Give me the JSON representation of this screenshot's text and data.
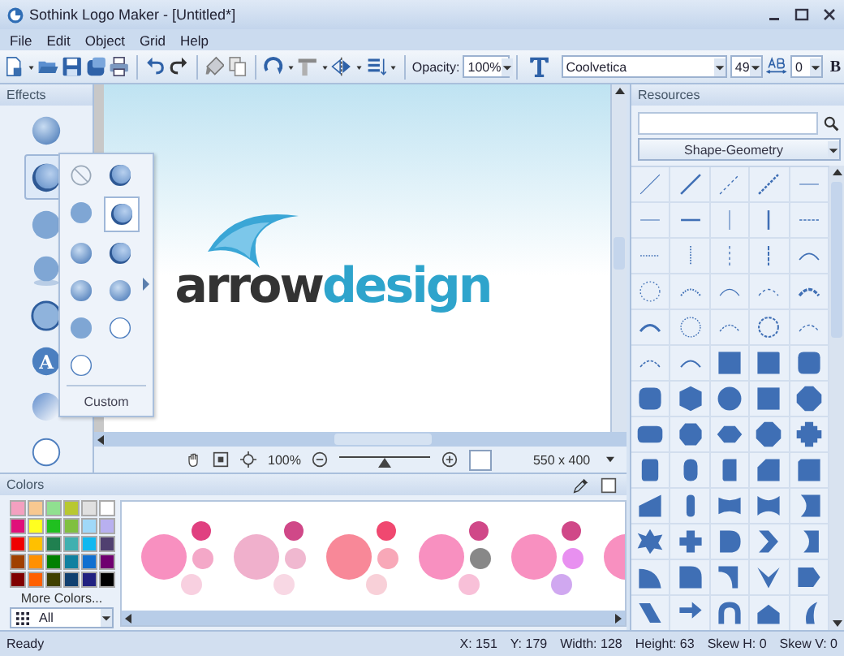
{
  "window": {
    "title": "Sothink Logo Maker - [Untitled*]"
  },
  "menu": [
    "File",
    "Edit",
    "Object",
    "Grid",
    "Help"
  ],
  "toolbar": {
    "opacity_label": "Opacity:",
    "opacity": "100%",
    "font": "Coolvetica",
    "font_size": "49",
    "spacing": "0",
    "bold": "B"
  },
  "effects_panel": {
    "title": "Effects",
    "items": [
      {
        "kind": "raised",
        "selected": false
      },
      {
        "kind": "ring",
        "selected": true
      },
      {
        "kind": "flat",
        "selected": false
      },
      {
        "kind": "shadow",
        "selected": false
      },
      {
        "kind": "outline",
        "selected": false
      },
      {
        "kind": "letter",
        "label": "A",
        "selected": false
      },
      {
        "kind": "gradient",
        "selected": false
      },
      {
        "kind": "hollow",
        "selected": false
      }
    ]
  },
  "effect_popup": {
    "options": [
      {
        "kind": "none",
        "selected": false
      },
      {
        "kind": "ring",
        "selected": false
      },
      {
        "kind": "flat",
        "selected": false
      },
      {
        "kind": "ring",
        "selected": true
      },
      {
        "kind": "raised",
        "selected": false
      },
      {
        "kind": "ring",
        "selected": false
      },
      {
        "kind": "raised",
        "selected": false
      },
      {
        "kind": "raised",
        "selected": false
      },
      {
        "kind": "flat",
        "selected": false
      },
      {
        "kind": "hollow",
        "selected": false
      },
      {
        "kind": "hollow",
        "selected": false
      }
    ],
    "custom": "Custom"
  },
  "canvas": {
    "logo": [
      {
        "text": "arrow",
        "color": "#333333"
      },
      {
        "text": "design",
        "color": "#2ea4cc"
      }
    ]
  },
  "canvas_toolbar": {
    "zoom": "100%",
    "zoom_slider": {
      "level": 0.5
    },
    "size": "550 x 400"
  },
  "colors_panel": {
    "title": "Colors",
    "swatches": [
      {
        "color": "#f4a0c0"
      },
      {
        "color": "#f8c890"
      },
      {
        "color": "#90e090"
      },
      {
        "color": "#b8c830"
      },
      {
        "color": "#e0e0e0"
      },
      {
        "color": "#ffffff"
      },
      {
        "color": "#e0107a"
      },
      {
        "color": "#ffff20"
      },
      {
        "color": "#20c020"
      },
      {
        "color": "#80c040"
      },
      {
        "color": "#a0d8f8"
      },
      {
        "color": "#b8b0f0"
      },
      {
        "color": "#f00000"
      },
      {
        "color": "#ffc000"
      },
      {
        "color": "#208050"
      },
      {
        "color": "#40b0b0"
      },
      {
        "color": "#10b8f0"
      },
      {
        "color": "#504070"
      },
      {
        "color": "#a04000"
      },
      {
        "color": "#ff9000"
      },
      {
        "color": "#008000"
      },
      {
        "color": "#1080a0"
      },
      {
        "color": "#1070d0"
      },
      {
        "color": "#700070"
      },
      {
        "color": "#800000"
      },
      {
        "color": "#ff6000"
      },
      {
        "color": "#404000"
      },
      {
        "color": "#104070"
      },
      {
        "color": "#202080"
      },
      {
        "color": "#000000"
      }
    ],
    "more_colors": "More Colors...",
    "filter": "All",
    "schemes": [
      {
        "swatches": [
          {
            "color": "#f890c0"
          },
          {
            "color": "#e04080"
          },
          {
            "color": "#f4a8c8"
          },
          {
            "color": "#f8d0e0"
          }
        ]
      },
      {
        "swatches": [
          {
            "color": "#f0b0cc"
          },
          {
            "color": "#d04888"
          },
          {
            "color": "#f0b8d0"
          },
          {
            "color": "#f8d8e4"
          }
        ]
      },
      {
        "swatches": [
          {
            "color": "#f88898"
          },
          {
            "color": "#f04870"
          },
          {
            "color": "#f8a8b8"
          },
          {
            "color": "#f8d0d8"
          }
        ]
      },
      {
        "swatches": [
          {
            "color": "#f890c0"
          },
          {
            "color": "#d04888"
          },
          {
            "color": "#888888"
          },
          {
            "color": "#f8c0d8"
          }
        ]
      },
      {
        "swatches": [
          {
            "color": "#f890c0"
          },
          {
            "color": "#d04888"
          },
          {
            "color": "#e890f0"
          },
          {
            "color": "#d0a8f0"
          }
        ]
      },
      {
        "swatches": [
          {
            "color": "#f890c0"
          }
        ]
      }
    ]
  },
  "resources_panel": {
    "title": "Resources",
    "category": "Shape-Geometry"
  },
  "status_bar": {
    "message": "Ready",
    "fields": [
      "X: 151",
      "Y: 179",
      "Width: 128",
      "Height: 63",
      "Skew H: 0",
      "Skew V: 0"
    ]
  }
}
